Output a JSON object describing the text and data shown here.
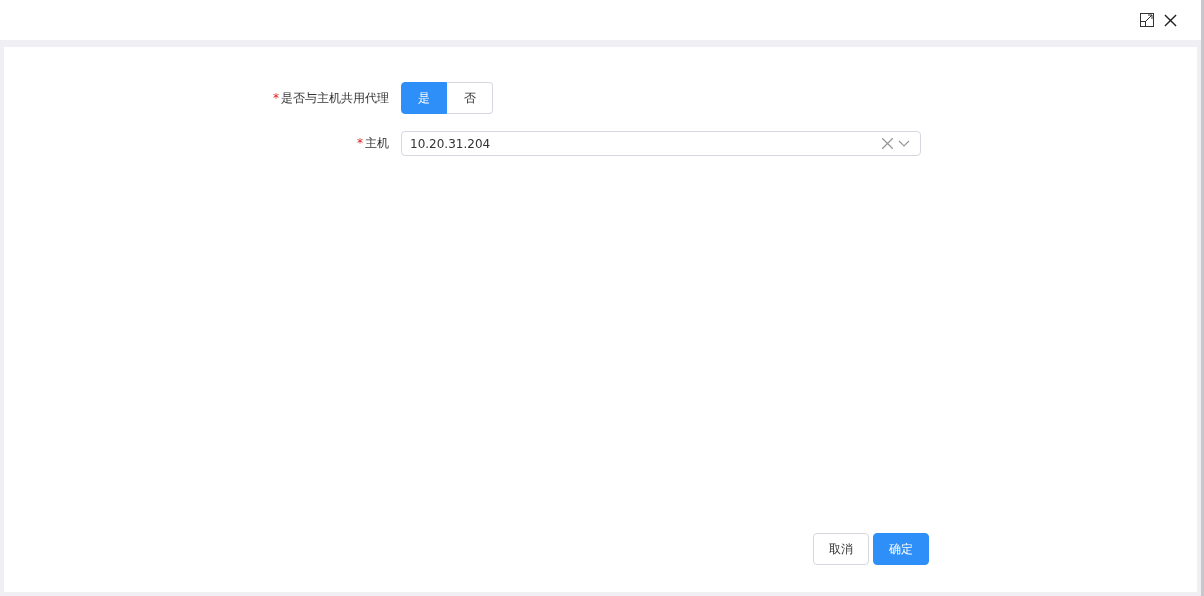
{
  "form": {
    "fields": [
      {
        "kind": "radio",
        "label": "是否与主机共用代理",
        "required_mark": "*",
        "options": [
          {
            "label": "是",
            "selected": true
          },
          {
            "label": "否",
            "selected": false
          }
        ]
      },
      {
        "kind": "select",
        "label": "主机",
        "required_mark": "*",
        "value": "10.20.31.204"
      }
    ]
  },
  "buttons": [
    {
      "label": "取消",
      "kind": "default"
    },
    {
      "label": "确定",
      "kind": "primary"
    }
  ]
}
